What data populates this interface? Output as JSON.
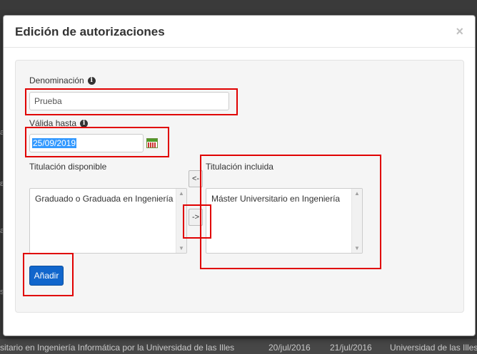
{
  "background": {
    "left_fragments": [
      "a",
      "ε",
      "a",
      "s",
      "e"
    ],
    "strip_cells": [
      "sitario en Ingeniería Informática por la Universidad de las Illes",
      "20/jul/2016",
      "21/jul/2016",
      "Universidad de las Illes"
    ]
  },
  "modal": {
    "title": "Edición de autorizaciones",
    "close_glyph": "×"
  },
  "form": {
    "denominacion_label": "Denominación",
    "denominacion_value": "Prueba",
    "valida_hasta_label": "Válida hasta",
    "valida_hasta_value": "25/09/2019",
    "titulacion_disponible_label": "Titulación disponible",
    "titulacion_disponible_items": [
      "Graduado o Graduada en Ingeniería"
    ],
    "titulacion_incluida_label": "Titulación incluida",
    "titulacion_incluida_items": [
      "Máster Universitario en Ingeniería"
    ],
    "move_left_label": "<-",
    "move_right_label": "->",
    "add_button_label": "Añadir"
  },
  "icons": {
    "info": "info-circle-icon",
    "calendar": "calendar-icon",
    "scroll_up": "scroll-up-arrow-icon",
    "scroll_down": "scroll-down-arrow-icon"
  },
  "colors": {
    "primary_button": "#1166cc",
    "highlight": "#e00000",
    "selection": "#3399ff"
  }
}
